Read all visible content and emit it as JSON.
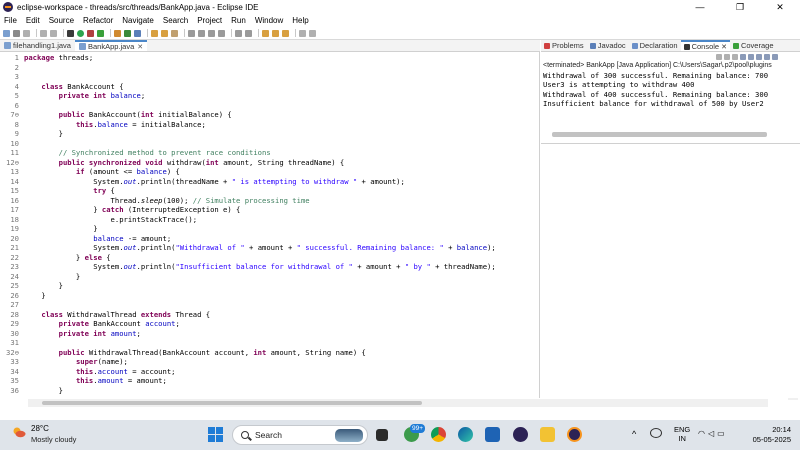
{
  "window": {
    "title": "eclipse-workspace - threads/src/threads/BankApp.java - Eclipse IDE",
    "minimize": "—",
    "maximize": "❐",
    "close": "✕"
  },
  "menu": [
    "File",
    "Edit",
    "Source",
    "Refactor",
    "Navigate",
    "Search",
    "Project",
    "Run",
    "Window",
    "Help"
  ],
  "editor_tabs": [
    {
      "label": "filehandling1.java",
      "active": false
    },
    {
      "label": "BankApp.java",
      "active": true
    }
  ],
  "code_lines": [
    {
      "n": "1",
      "html": "<span class='kw'>package</span> threads;"
    },
    {
      "n": "2",
      "html": ""
    },
    {
      "n": "3",
      "html": ""
    },
    {
      "n": "4",
      "html": "    <span class='kw'>class</span> BankAccount {"
    },
    {
      "n": "5",
      "html": "        <span class='kw'>private</span> <span class='kw'>int</span> <span class='fld'>balance</span>;"
    },
    {
      "n": "6",
      "html": ""
    },
    {
      "n": "7⊖",
      "html": "        <span class='kw'>public</span> BankAccount(<span class='kw'>int</span> initialBalance) {"
    },
    {
      "n": "8",
      "html": "            <span class='kw'>this</span>.<span class='fld'>balance</span> = initialBalance;"
    },
    {
      "n": "9",
      "html": "        }"
    },
    {
      "n": "10",
      "html": ""
    },
    {
      "n": "11",
      "html": "        <span class='cm'>// Synchronized method to prevent race conditions</span>"
    },
    {
      "n": "12⊖",
      "html": "        <span class='kw'>public</span> <span class='kw'>synchronized</span> <span class='kw'>void</span> withdraw(<span class='kw'>int</span> amount, String threadName) {"
    },
    {
      "n": "13",
      "html": "            <span class='kw'>if</span> (amount &lt;= <span class='fld'>balance</span>) {"
    },
    {
      "n": "14",
      "html": "                System.<span class='fld it'>out</span>.println(threadName + <span class='str'>\" is attempting to withdraw \"</span> + amount);"
    },
    {
      "n": "15",
      "html": "                <span class='kw'>try</span> {"
    },
    {
      "n": "16",
      "html": "                    Thread.<span class='it'>sleep</span>(100); <span class='cm'>// Simulate processing time</span>"
    },
    {
      "n": "17",
      "html": "                } <span class='kw'>catch</span> (InterruptedException e) {"
    },
    {
      "n": "18",
      "html": "                    e.printStackTrace();"
    },
    {
      "n": "19",
      "html": "                }"
    },
    {
      "n": "20",
      "html": "                <span class='fld'>balance</span> -= amount;"
    },
    {
      "n": "21",
      "html": "                System.<span class='fld it'>out</span>.println(<span class='str'>\"Withdrawal of \"</span> + amount + <span class='str'>\" successful. Remaining balance: \"</span> + <span class='fld'>balance</span>);"
    },
    {
      "n": "22",
      "html": "            } <span class='kw'>else</span> {"
    },
    {
      "n": "23",
      "html": "                System.<span class='fld it'>out</span>.println(<span class='str'>\"Insufficient balance for withdrawal of \"</span> + amount + <span class='str'>\" by \"</span> + threadName);"
    },
    {
      "n": "24",
      "html": "            }"
    },
    {
      "n": "25",
      "html": "        }"
    },
    {
      "n": "26",
      "html": "    }"
    },
    {
      "n": "27",
      "html": ""
    },
    {
      "n": "28",
      "html": "    <span class='kw'>class</span> WithdrawalThread <span class='kw'>extends</span> Thread {"
    },
    {
      "n": "29",
      "html": "        <span class='kw'>private</span> BankAccount <span class='fld'>account</span>;"
    },
    {
      "n": "30",
      "html": "        <span class='kw'>private</span> <span class='kw'>int</span> <span class='fld'>amount</span>;"
    },
    {
      "n": "31",
      "html": ""
    },
    {
      "n": "32⊖",
      "html": "        <span class='kw'>public</span> WithdrawalThread(BankAccount account, <span class='kw'>int</span> amount, String name) {"
    },
    {
      "n": "33",
      "html": "            <span class='kw'>super</span>(name);"
    },
    {
      "n": "34",
      "html": "            <span class='kw'>this</span>.<span class='fld'>account</span> = account;"
    },
    {
      "n": "35",
      "html": "            <span class='kw'>this</span>.<span class='fld'>amount</span> = amount;"
    },
    {
      "n": "36",
      "html": "        }"
    }
  ],
  "console_tabs": [
    {
      "label": "Problems",
      "active": false,
      "color": "#d04040"
    },
    {
      "label": "Javadoc",
      "active": false,
      "color": "#5a7fb8"
    },
    {
      "label": "Declaration",
      "active": false,
      "color": "#6a8fc8"
    },
    {
      "label": "Console",
      "active": true,
      "color": "#333333"
    },
    {
      "label": "Coverage",
      "active": false,
      "color": "#3aa03a"
    }
  ],
  "console": {
    "terminated": "<terminated> BankApp [Java Application] C:\\Users\\Sagar\\.p2\\pool\\plugins",
    "lines": [
      "Withdrawal of 300 successful. Remaining balance: 700",
      "User3 is attempting to withdraw 400",
      "Withdrawal of 400 successful. Remaining balance: 300",
      "Insufficient balance for withdrawal of 500 by User2"
    ]
  },
  "taskbar": {
    "temperature": "28°C",
    "weather": "Mostly cloudy",
    "search_placeholder": "Search",
    "badge": "99+",
    "lang_line1": "ENG",
    "lang_line2": "IN",
    "time": "20:14",
    "date": "05-05-2025"
  }
}
